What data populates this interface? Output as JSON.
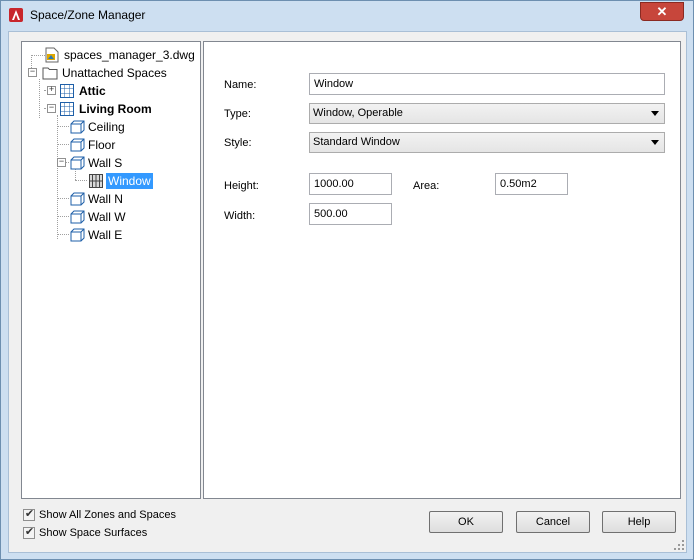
{
  "window": {
    "title": "Space/Zone Manager",
    "close_glyph": "✕",
    "accent_color": "#c7463b"
  },
  "tree": {
    "root": {
      "label": "spaces_manager_3.dwg",
      "icon": "dwg-file-icon"
    },
    "group": {
      "label": "Unattached Spaces",
      "icon": "folder-icon"
    },
    "attic": {
      "label": "Attic",
      "icon": "space-icon",
      "expander": "+"
    },
    "living_room": {
      "label": "Living Room",
      "icon": "space-icon",
      "expander": "−"
    },
    "ceiling": {
      "label": "Ceiling",
      "icon": "surface-icon"
    },
    "floor": {
      "label": "Floor",
      "icon": "surface-icon"
    },
    "wall_s": {
      "label": "Wall S",
      "icon": "surface-icon",
      "expander": "−"
    },
    "window": {
      "label": "Window",
      "icon": "window-opening-icon"
    },
    "wall_n": {
      "label": "Wall N",
      "icon": "surface-icon"
    },
    "wall_w": {
      "label": "Wall W",
      "icon": "surface-icon"
    },
    "wall_e": {
      "label": "Wall E",
      "icon": "surface-icon"
    }
  },
  "props": {
    "name_label": "Name:",
    "name_value": "Window",
    "type_label": "Type:",
    "type_value": "Window, Operable",
    "style_label": "Style:",
    "style_value": "Standard Window",
    "height_label": "Height:",
    "height_value": "1000.00",
    "area_label": "Area:",
    "area_value": "0.50m2",
    "width_label": "Width:",
    "width_value": "500.00"
  },
  "options": {
    "show_all_zones": {
      "label": "Show All Zones and Spaces",
      "checked": true
    },
    "show_surfaces": {
      "label": "Show Space Surfaces",
      "checked": true
    },
    "check_glyph": "✔"
  },
  "buttons": {
    "ok": "OK",
    "cancel": "Cancel",
    "help": "Help"
  }
}
